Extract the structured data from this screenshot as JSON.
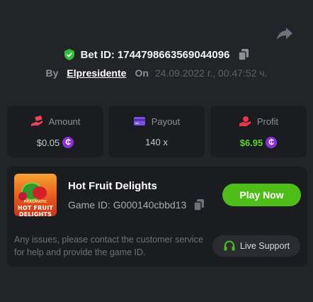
{
  "bet": {
    "label": "Bet ID:",
    "id": "1744798663569044096"
  },
  "by": {
    "by_label": "By",
    "username": "Elpresidente",
    "on_label": "On",
    "date": "24.09.2022 г., 00:47:52 ч."
  },
  "stats": {
    "amount": {
      "label": "Amount",
      "value": "$0.05"
    },
    "payout": {
      "label": "Payout",
      "value": "140 x"
    },
    "profit": {
      "label": "Profit",
      "value": "$6.95"
    }
  },
  "game": {
    "thumb_line1": "PRAGMATIC",
    "thumb_line2": "HOT FRUIT DELIGHTS",
    "title": "Hot Fruit Delights",
    "id_label": "Game ID:",
    "id_value": "G000140cbbd13",
    "play_label": "Play Now"
  },
  "support": {
    "notice": "Any issues, please contact the customer service for help and provide the game ID.",
    "button_label": "Live Support"
  },
  "coin_symbol": "₵",
  "icons": {
    "share": "share-icon",
    "shield": "shield-check-icon",
    "copy": "copy-icon",
    "amount": "money-hand-icon",
    "payout": "card-icon",
    "profit": "profit-hand-icon",
    "support": "headset-icon"
  },
  "colors": {
    "background": "#232428",
    "card": "#1b1c1f",
    "accent_green": "#4fbd17",
    "profit_green": "#5bd333",
    "coin_purple": "#8d2fe0",
    "amount_icon": "#e9445a",
    "payout_icon": "#7a4fe6",
    "profit_icon": "#e8344a"
  }
}
